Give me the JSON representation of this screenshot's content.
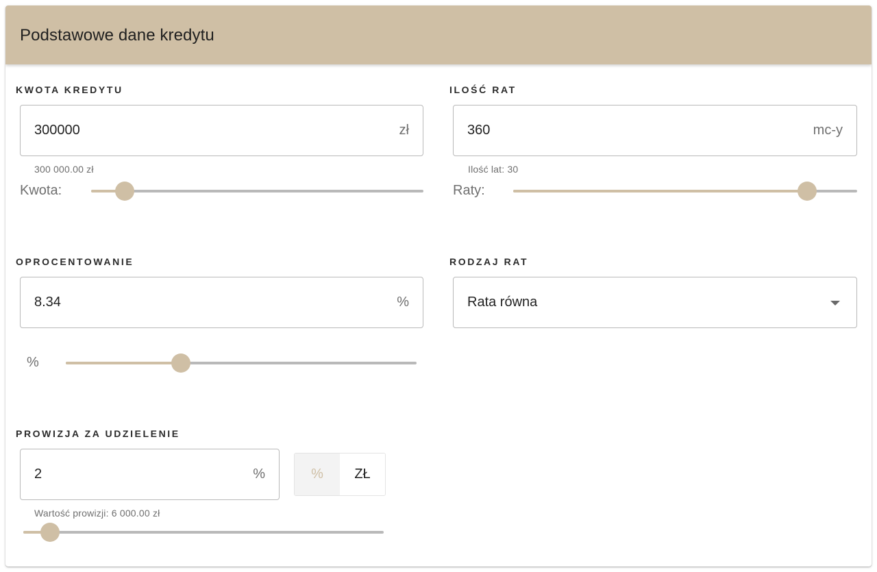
{
  "card": {
    "title": "Podstawowe dane kredytu"
  },
  "kwota": {
    "label": "KWOTA KREDYTU",
    "value": "300000",
    "unit": "zł",
    "helper": "300 000.00 zł",
    "slider_label": "Kwota:",
    "slider_fraction": 0.1
  },
  "raty": {
    "label": "ILOŚĆ RAT",
    "value": "360",
    "unit": "mc-y",
    "helper": "Ilość lat: 30",
    "slider_label": "Raty:",
    "slider_fraction": 0.854
  },
  "oprocentowanie": {
    "label": "OPROCENTOWANIE",
    "value": "8.34",
    "unit": "%",
    "slider_label": "%",
    "slider_fraction": 0.329
  },
  "rodzaj": {
    "label": "RODZAJ RAT",
    "selected": "Rata równa"
  },
  "prowizja": {
    "label": "PROWIZJA ZA UDZIELENIE",
    "value": "2",
    "unit": "%",
    "toggle_options": [
      "%",
      "ZŁ"
    ],
    "toggle_active": "%",
    "helper": "Wartość prowizji: 6 000.00 zł",
    "slider_fraction": 0.075
  },
  "colors": {
    "accent": "#cfbfa5",
    "track": "#b9b9b9",
    "border": "#b9b9b9"
  }
}
